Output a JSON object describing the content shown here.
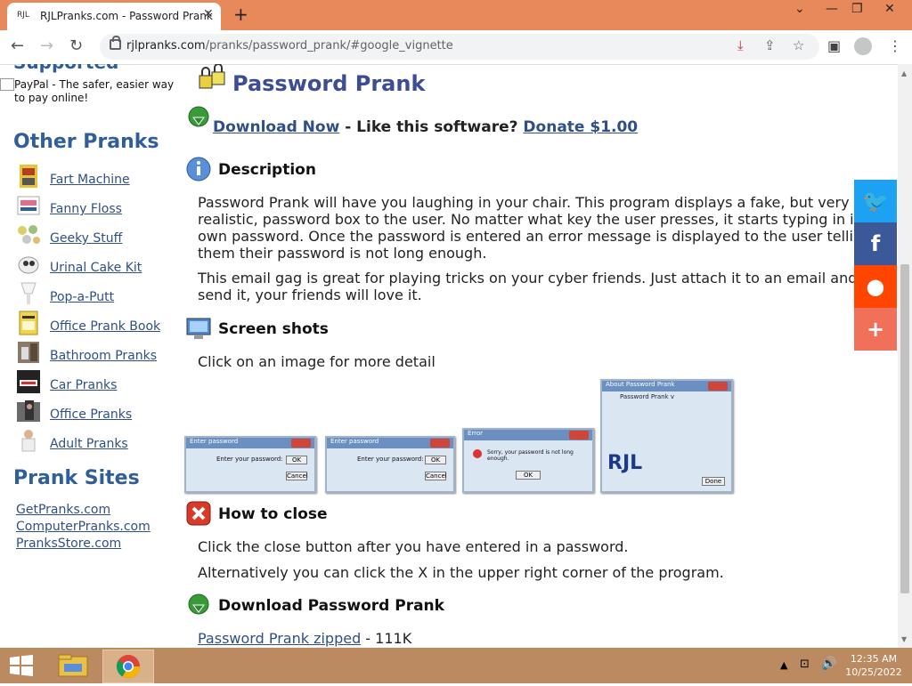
{
  "browser": {
    "tab_favicon": "RJL",
    "tab_title": "RJLPranks.com - Password Prank",
    "url_host": "rjlpranks.com",
    "url_path": "/pranks/password_prank/#google_vignette"
  },
  "sidebar": {
    "supported_heading": "Supported",
    "paypal_alt": "PayPal - The safer, easier way to pay online!",
    "other_pranks_heading": "Other Pranks",
    "pranks": [
      {
        "label": "Fart Machine"
      },
      {
        "label": "Fanny Floss"
      },
      {
        "label": "Geeky Stuff"
      },
      {
        "label": "Urinal Cake Kit"
      },
      {
        "label": "Pop-a-Putt"
      },
      {
        "label": "Office Prank Book"
      },
      {
        "label": "Bathroom Pranks"
      },
      {
        "label": "Car Pranks"
      },
      {
        "label": "Office Pranks"
      },
      {
        "label": "Adult Pranks"
      }
    ],
    "prank_sites_heading": "Prank Sites",
    "sites": [
      "GetPranks.com",
      "ComputerPranks.com",
      "PranksStore.com"
    ]
  },
  "main": {
    "title": "Password Prank",
    "download_now": "Download Now",
    "like_text": " - Like this software? ",
    "donate": "Donate $1.00",
    "description_heading": "Description",
    "description_p1": "Password Prank will have you laughing in your chair. This program displays a fake, but very realistic, password box to the user. No matter what key the user presses, it starts typing in its own password. Once the password is entered an error message is displayed to the user telling them their password is not long enough.",
    "description_p2": "This email gag is great for playing tricks on your cyber friends. Just attach it to an email and send it, your friends will love it.",
    "screenshots_heading": "Screen shots",
    "screenshots_hint": "Click on an image for more detail",
    "screenshots": [
      {
        "title": "Enter password",
        "text": "Enter your password:",
        "ok": "OK",
        "cancel": "Cancel"
      },
      {
        "title": "Enter password",
        "text": "Enter your password:",
        "ok": "OK",
        "cancel": "Cancel"
      },
      {
        "title": "Error",
        "text": "Sorry, your password is not long enough.",
        "ok": "OK"
      },
      {
        "title": "About Password Prank",
        "text": "Password Prank v",
        "ok": "Done"
      }
    ],
    "howto_heading": "How to close",
    "howto_p1": "Click the close button after you have entered in a password.",
    "howto_p2": "Alternatively you can click the X in the upper right corner of the program.",
    "download_heading": "Download Password Prank",
    "zip_link": "Password Prank zipped",
    "zip_size": " - 111K"
  },
  "share": [
    {
      "name": "twitter",
      "glyph": "🐦",
      "color": "#1da1f2"
    },
    {
      "name": "facebook",
      "glyph": "f",
      "color": "#3b5998"
    },
    {
      "name": "reddit",
      "glyph": "●",
      "color": "#ff4500"
    },
    {
      "name": "more",
      "glyph": "+",
      "color": "#f0705a"
    }
  ],
  "taskbar": {
    "time": "12:35 AM",
    "date": "10/25/2022"
  }
}
